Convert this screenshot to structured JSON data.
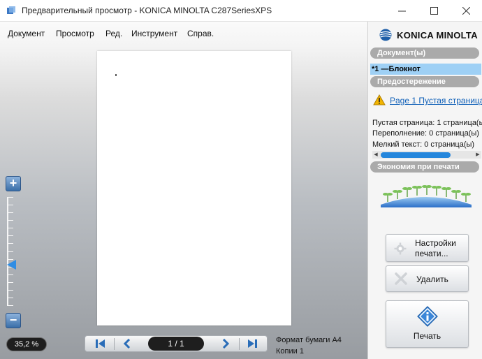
{
  "window": {
    "title": "Предварительный просмотр - KONICA MINOLTA C287SeriesXPS",
    "controls": {
      "minimize": "—",
      "maximize": "☐",
      "close": "✕"
    }
  },
  "menu": [
    "Документ",
    "Просмотр",
    "Ред.",
    "Инструмент",
    "Справ."
  ],
  "zoom": {
    "value": "35,2 %",
    "level": 0.38
  },
  "navigation": {
    "page_indicator": "1 / 1"
  },
  "paper": {
    "format": "Формат бумаги A4",
    "copies": "Копии 1"
  },
  "sidebar": {
    "brand": "KONICA MINOLTA",
    "documents_header": "Документ(ы)",
    "document_item": "*1 —Блокнот",
    "warning_header": "Предостережение",
    "warning_link": "Page 1 Пустая страница",
    "stats": [
      "Пустая страница: 1 страница(ы)",
      "Переполнение: 0 страница(ы)",
      "Мелкий текст: 0 страница(ы)"
    ],
    "economy_header": "Экономия при печати"
  },
  "buttons": {
    "settings_line1": "Настройки",
    "settings_line2": "печати...",
    "delete": "Удалить",
    "print": "Печать"
  },
  "colors": {
    "accent": "#2486dc",
    "selection": "#9ed0f5",
    "brand_blue": "#1f5fa8",
    "warning": "#f2b400"
  }
}
